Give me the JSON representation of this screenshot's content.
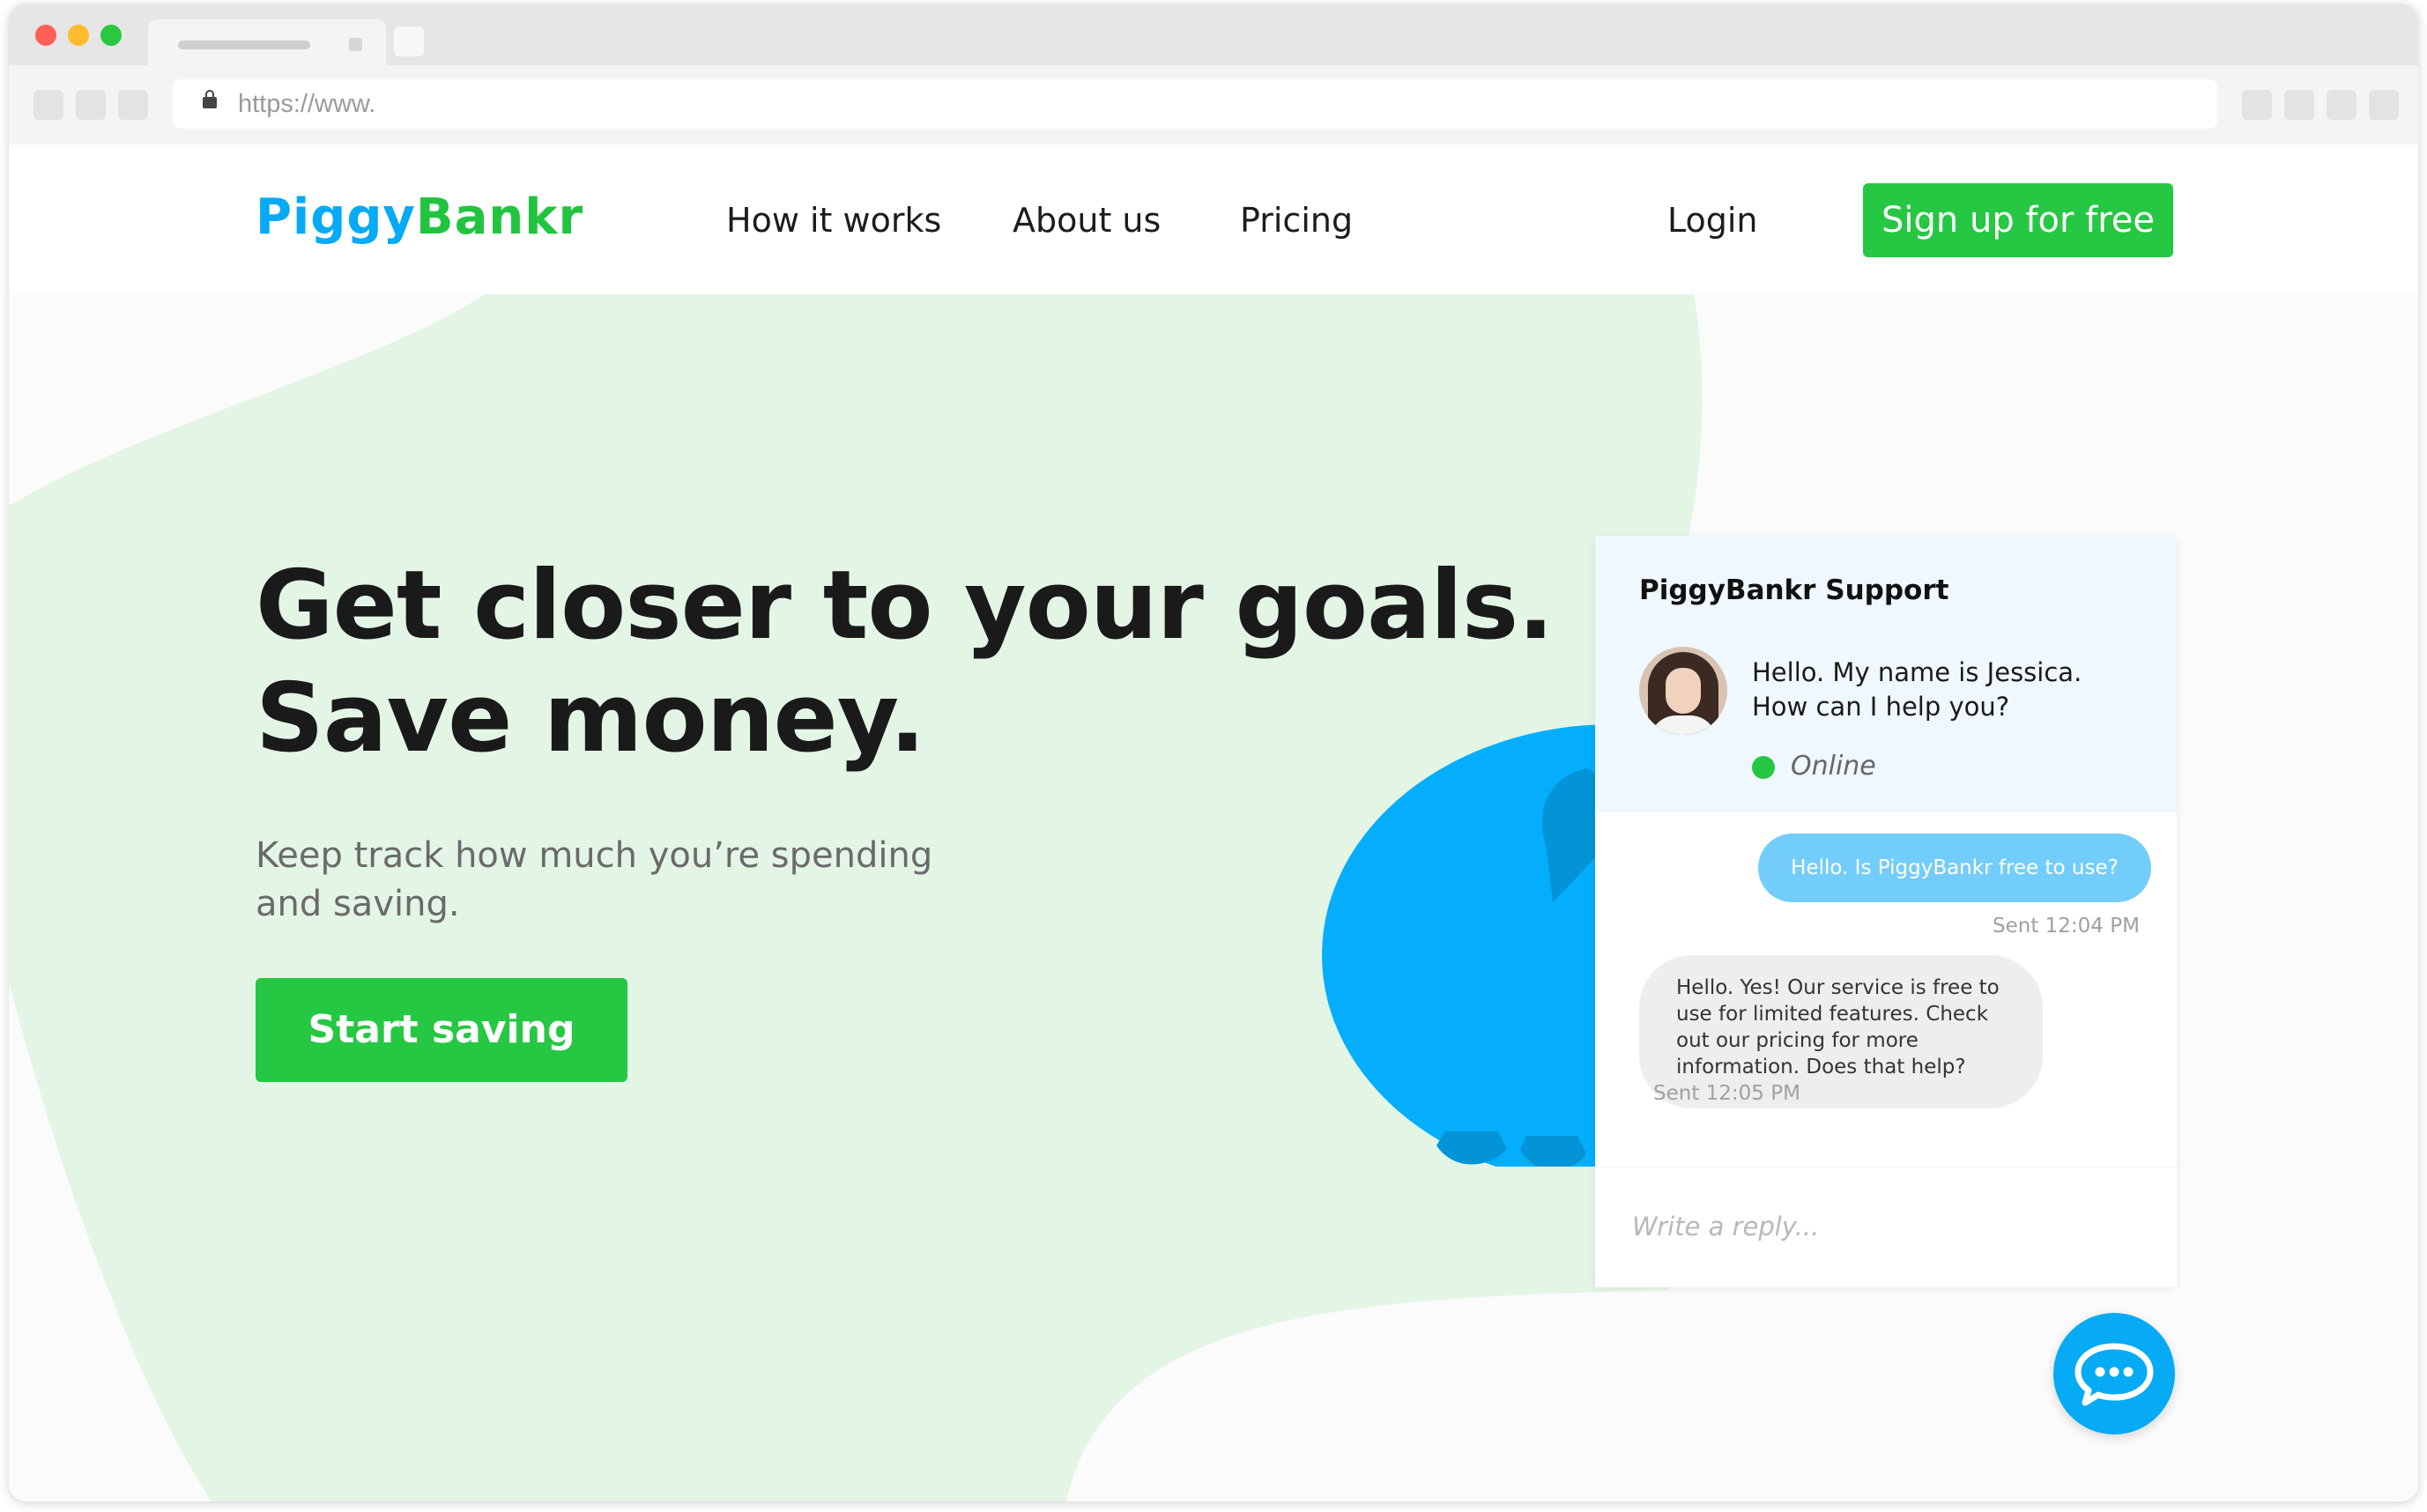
{
  "browser": {
    "url": "https://www."
  },
  "header": {
    "logo_part1": "Piggy",
    "logo_part2": "Bankr",
    "nav": [
      "How it works",
      "About us",
      "Pricing"
    ],
    "login_label": "Login",
    "signup_label": "Sign up for free"
  },
  "hero": {
    "title": "Get closer to your goals.\nSave money.",
    "subtitle": "Keep track how much you’re spending and saving.",
    "cta_label": "Start saving"
  },
  "chat": {
    "title": "PiggyBankr Support",
    "greeting": "Hello. My name is Jessica. How can I help you?",
    "status": "Online",
    "messages": [
      {
        "direction": "out",
        "text": "Hello. Is PiggyBankr free to use?",
        "meta": "Sent 12:04 PM"
      },
      {
        "direction": "in",
        "text": "Hello. Yes! Our service is free to use for limited features. Check out our pricing for more information. Does that help?",
        "meta": "Sent 12:05 PM"
      }
    ],
    "reply_placeholder": "Write a reply..."
  },
  "colors": {
    "brand_blue": "#06aaf5",
    "brand_green": "#26c743",
    "hero_blob": "#e3f6e6",
    "outgoing_bubble": "#73cdfb"
  },
  "icons": {
    "lock": "lock-icon",
    "chat_fab": "chat-bubble-icon"
  }
}
